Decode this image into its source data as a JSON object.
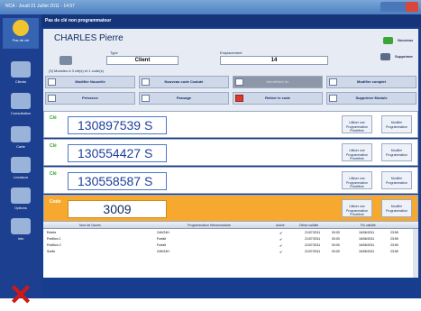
{
  "window": {
    "title": "NCA - Jeudi 21 Juillet 2011 - 14:57"
  },
  "sidebar": {
    "items": [
      {
        "label": "Pas de clé",
        "icon": "key-circle-icon"
      },
      {
        "label": "Clients",
        "icon": "clients-icon"
      },
      {
        "label": "Consultation",
        "icon": "consultation-icon"
      },
      {
        "label": "Carte",
        "icon": "card-icon"
      },
      {
        "label": "Livraison",
        "icon": "delivery-icon"
      },
      {
        "label": "Options",
        "icon": "options-icon"
      },
      {
        "label": "Info",
        "icon": "info-icon"
      }
    ],
    "exit_icon": "close-x-icon"
  },
  "topbar": {
    "title": "Pas de clé non programmateur"
  },
  "header": {
    "owner": "CHARLES Pierre",
    "type_label": "Type",
    "type_value": "Client",
    "location_label": "Emplacement",
    "location_value": "14",
    "new_button": "Nouveau",
    "delete_button": "Supprimer",
    "counts_text": "(3) Modules à 3 clé(s) et 1 code(s)"
  },
  "toolbar": {
    "modify": "Modifier Nouvelle",
    "new_card": "Nouveau code Ccaluté",
    "disabled1": "Identifiant de",
    "modify_complete": "Modifier complet",
    "presence": "Présence",
    "passage": "Passage",
    "delete_code": "Retirer le code",
    "delete_module": "Supprimer Module"
  },
  "code_rows": [
    {
      "type": "Clé",
      "code": "130897539 S",
      "btn1": "Utiliser une Programmation Prédéfinie",
      "btn2": "Modifier Programmation"
    },
    {
      "type": "Clé",
      "code": "130554427 S",
      "btn1": "Utiliser une Programmation Prédéfinie",
      "btn2": "Modifier Programmation"
    },
    {
      "type": "Clé",
      "code": "130558587 S",
      "btn1": "Utiliser une Programmation Prédéfinie",
      "btn2": "Modifier Programmation"
    },
    {
      "type": "Code",
      "code": "3009",
      "btn1": "Utiliser une Programmation Prédéfinie",
      "btn2": "Modifier Programmation"
    }
  ],
  "table": {
    "headers": [
      "Nom de l'accès",
      "Programmation Hebdomadaire",
      "Activé",
      "Début validité",
      "",
      "Fin validité",
      ""
    ],
    "rows": [
      [
        "Entrée",
        "24H/24H",
        "✔",
        "21/07/2011",
        "00:00",
        "16/06/2011",
        "23:59"
      ],
      [
        "Portillon 1",
        "Forfait",
        "✔",
        "21/07/2011",
        "00:00",
        "16/06/2011",
        "23:59"
      ],
      [
        "Portillon 2",
        "Forfait",
        "✔",
        "21/07/2011",
        "00:00",
        "16/06/2011",
        "23:59"
      ],
      [
        "Sortie",
        "24H/24H",
        "✔",
        "21/07/2011",
        "00:00",
        "16/06/2011",
        "23:59"
      ]
    ]
  },
  "colors": {
    "sidebar": "#1d3f8f",
    "accent_green": "#2ca52c",
    "accent_orange": "#f7a92f"
  }
}
